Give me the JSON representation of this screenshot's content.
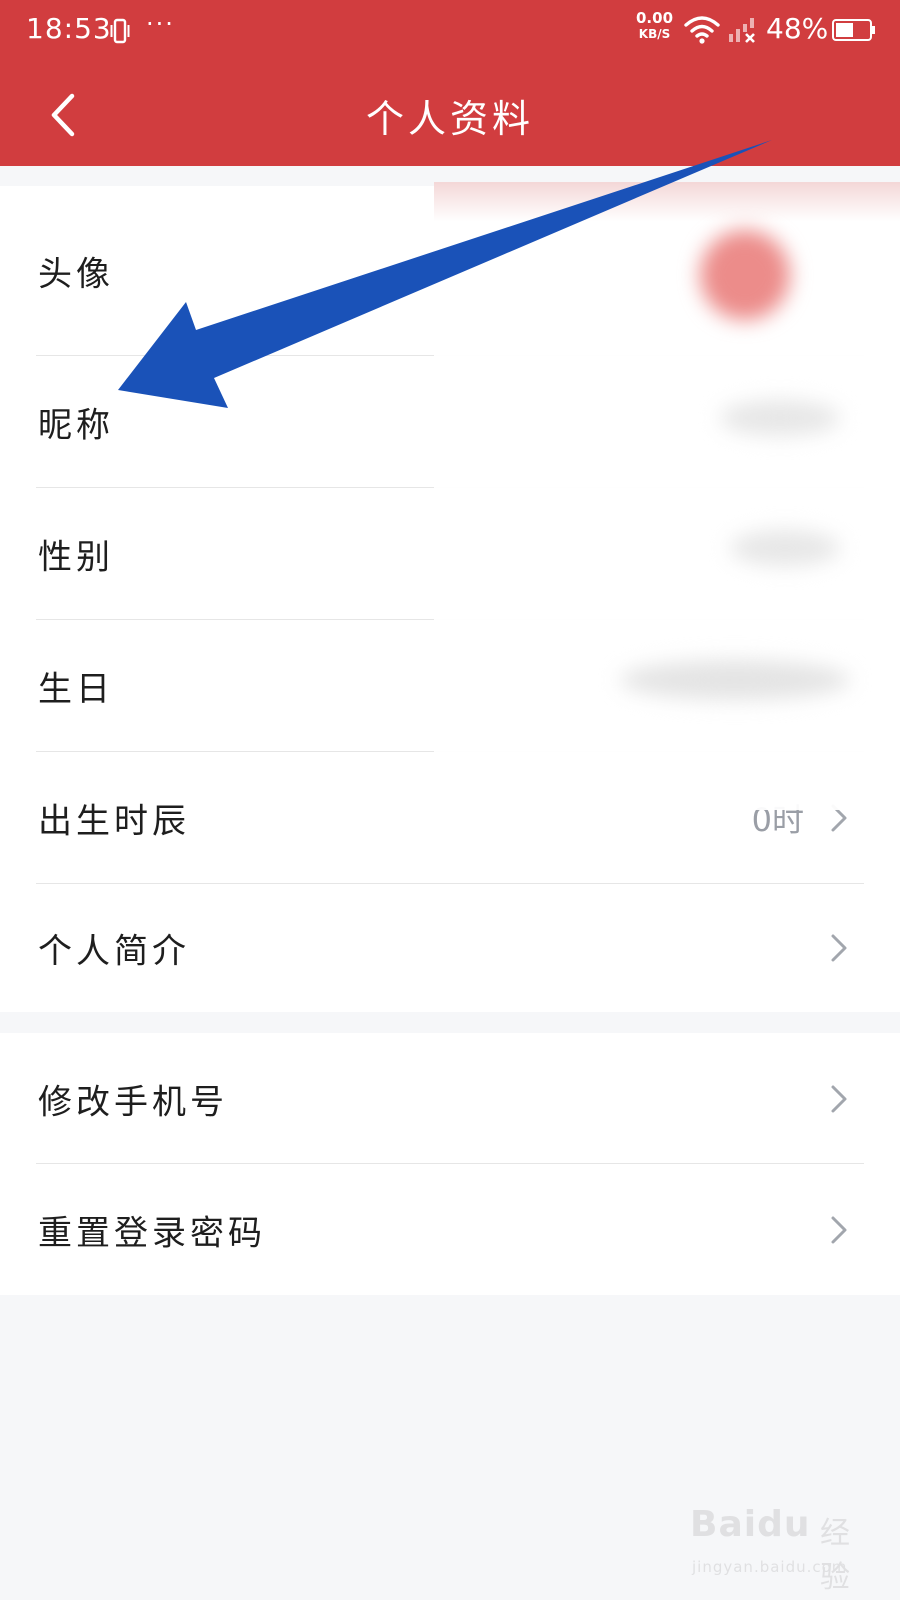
{
  "status_bar": {
    "time": "18:53",
    "more_dots": "···",
    "net_speed_value": "0.00",
    "net_speed_unit": "KB/S",
    "battery_percent": "48%"
  },
  "nav": {
    "title": "个人资料"
  },
  "profile_items": [
    {
      "label": "头像"
    },
    {
      "label": "昵称"
    },
    {
      "label": "性别"
    },
    {
      "label": "生日"
    },
    {
      "label": "出生时辰",
      "value": "0时"
    },
    {
      "label": "个人简介"
    }
  ],
  "account_items": [
    {
      "label": "修改手机号"
    },
    {
      "label": "重置登录密码"
    }
  ],
  "watermark": {
    "brand": "Baidu",
    "sub": "经验",
    "url": "jingyan.baidu.com"
  },
  "colors": {
    "header": "#d13d3f",
    "annotation_arrow": "#1a52b8",
    "background": "#f6f7f9"
  }
}
